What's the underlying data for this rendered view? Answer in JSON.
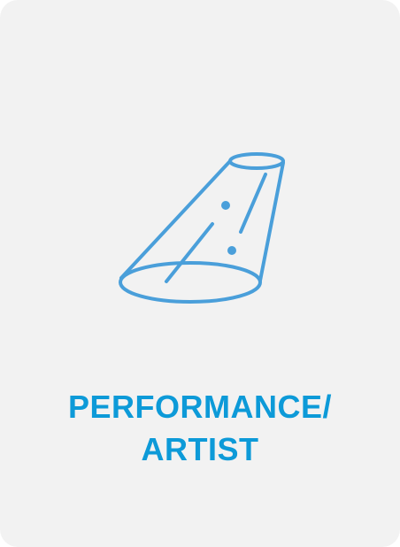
{
  "card": {
    "title_line1": "PERFORMANCE/",
    "title_line2": "ARTIST",
    "icon": "spotlight-icon",
    "colors": {
      "background": "#f2f2f2",
      "accent": "#0d9ad8",
      "icon_stroke": "#4a9fda"
    }
  }
}
